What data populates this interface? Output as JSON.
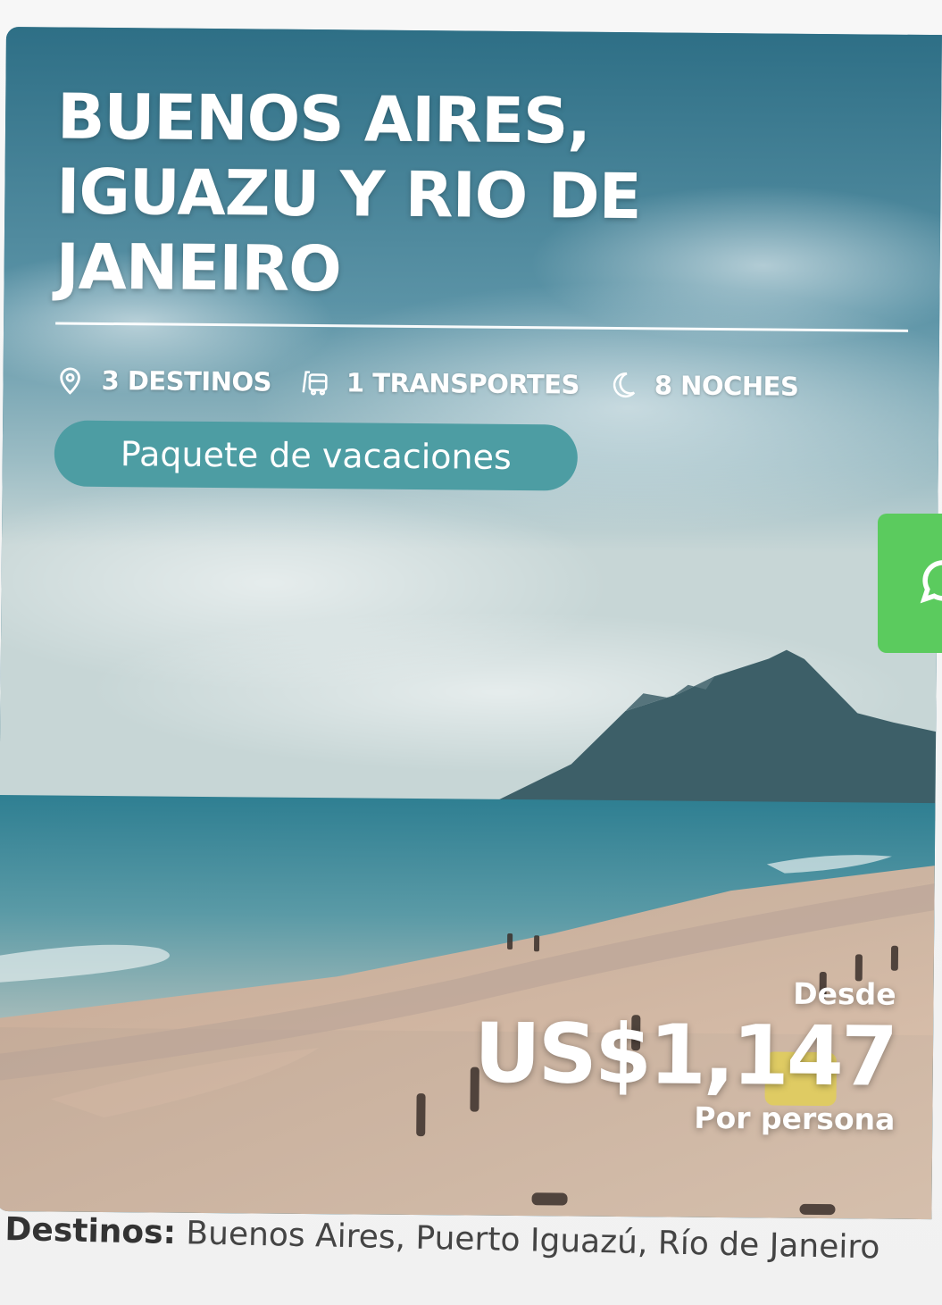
{
  "card": {
    "title": "BUENOS AIRES, IGUAZU Y RIO DE JANEIRO",
    "stats": [
      {
        "icon": "map-pin-icon",
        "label": "3 DESTINOS"
      },
      {
        "icon": "bus-icon",
        "label": "1 TRANSPORTES"
      },
      {
        "icon": "moon-icon",
        "label": "8 NOCHES"
      }
    ],
    "badge_label": "Paquete de vacaciones",
    "price": {
      "from_label": "Desde",
      "amount": "US$1,147",
      "per_label": "Por persona"
    }
  },
  "whatsapp": {
    "icon": "whatsapp-icon"
  },
  "destinations": {
    "label": "Destinos:",
    "value": "Buenos Aires, Puerto Iguazú, Río de Janeiro"
  },
  "colors": {
    "badge": "#4d9da3",
    "whatsapp": "#5bcb5e",
    "text_dark": "#444444"
  }
}
